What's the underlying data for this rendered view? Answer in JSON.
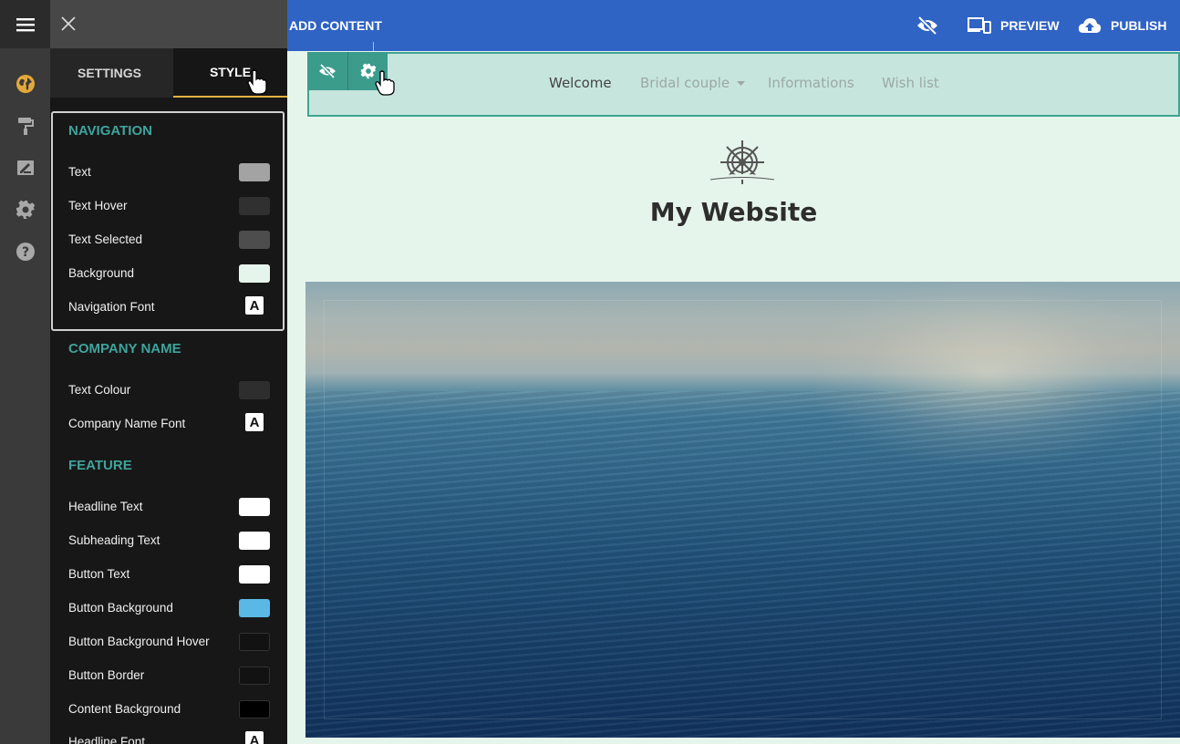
{
  "topbar": {
    "add_content": "ADD CONTENT",
    "preview": "PREVIEW",
    "publish": "PUBLISH"
  },
  "panel": {
    "tabs": [
      {
        "label": "SETTINGS",
        "active": false
      },
      {
        "label": "STYLE",
        "active": true
      }
    ],
    "navigation": {
      "title": "NAVIGATION",
      "rows": [
        {
          "label": "Text",
          "color": "#a3a3a3"
        },
        {
          "label": "Text Hover",
          "color": "#303030"
        },
        {
          "label": "Text Selected",
          "color": "#4d4d4d"
        },
        {
          "label": "Background",
          "color": "#e6f5ec"
        },
        {
          "label": "Navigation Font",
          "font_glyph": "A"
        }
      ]
    },
    "company_name": {
      "title": "COMPANY NAME",
      "rows": [
        {
          "label": "Text Colour",
          "color": "#2e2e2e"
        },
        {
          "label": "Company Name Font",
          "font_glyph": "A"
        }
      ]
    },
    "feature": {
      "title": "FEATURE",
      "rows": [
        {
          "label": "Headline Text",
          "color": "#ffffff"
        },
        {
          "label": "Subheading Text",
          "color": "#ffffff"
        },
        {
          "label": "Button Text",
          "color": "#ffffff"
        },
        {
          "label": "Button Background",
          "color": "#5ab8e6"
        },
        {
          "label": "Button Background Hover",
          "color": "#121212"
        },
        {
          "label": "Button Border",
          "color": "#121212"
        },
        {
          "label": "Content Background",
          "color": "#000000"
        },
        {
          "label": "Headline Font",
          "font_glyph": "A"
        }
      ]
    }
  },
  "rail_icons": [
    "globe-icon",
    "paint-roller-icon",
    "edit-image-icon",
    "gear-icon",
    "help-icon"
  ],
  "site": {
    "nav": [
      "Welcome",
      "Bridal couple",
      "Informations",
      "Wish list"
    ],
    "title": "My Website"
  },
  "colors": {
    "topbar": "#2f63c4",
    "accent_teal": "#3fa39c",
    "tab_underline": "#e3b23c",
    "canvas_bg": "#e6f5ec"
  }
}
